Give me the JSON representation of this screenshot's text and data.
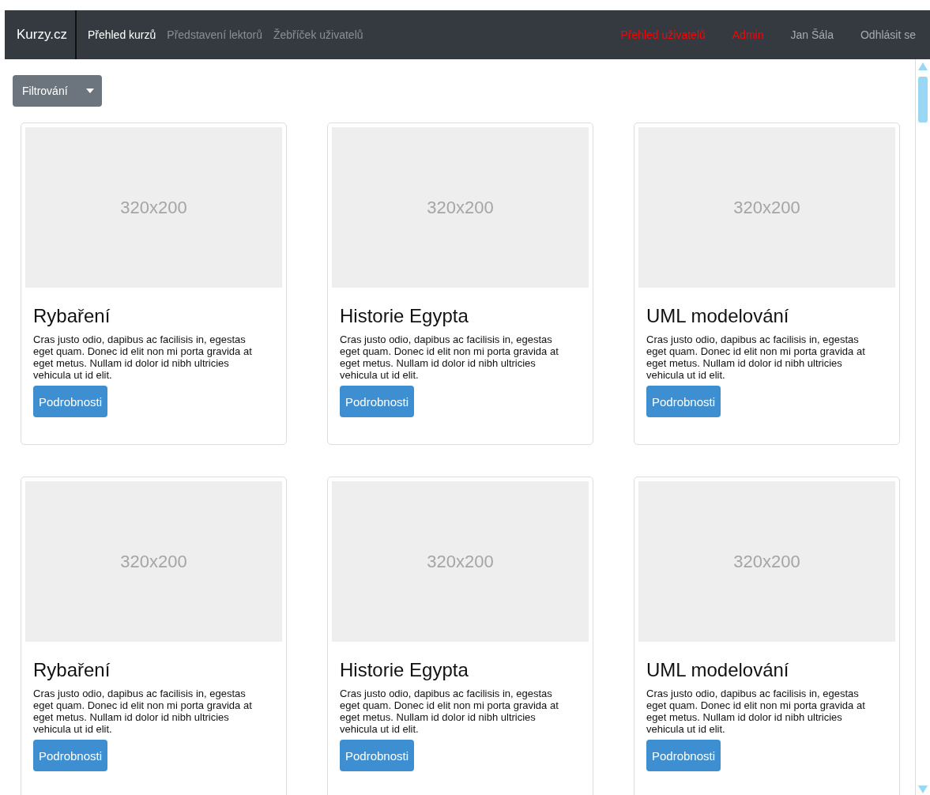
{
  "navbar": {
    "brand": "Kurzy.cz",
    "links": [
      {
        "label": "Přehled kurzů",
        "selected": true
      },
      {
        "label": "Představení lektorů",
        "selected": false
      },
      {
        "label": "Žebříček uživatelů",
        "selected": false
      }
    ],
    "right_links": [
      {
        "label": "Přehled uživatelů",
        "kind": "admin"
      },
      {
        "label": "Admin",
        "kind": "admin"
      },
      {
        "label": "Jan Šála",
        "kind": "user"
      },
      {
        "label": "Odhlásit se",
        "kind": "user"
      }
    ]
  },
  "filter_button": {
    "label": "Filtrování"
  },
  "cards": [
    {
      "image": "320x200",
      "title": "Rybaření",
      "text": "Cras justo odio, dapibus ac facilisis in, egestas eget quam. Donec id elit non mi porta gravida at eget metus. Nullam id dolor id nibh ultricies vehicula ut id elit.",
      "button": "Podrobnosti"
    },
    {
      "image": "320x200",
      "title": "Historie Egypta",
      "text": "Cras justo odio, dapibus ac facilisis in, egestas eget quam. Donec id elit non mi porta gravida at eget metus. Nullam id dolor id nibh ultricies vehicula ut id elit.",
      "button": "Podrobnosti"
    },
    {
      "image": "320x200",
      "title": "UML modelování",
      "text": "Cras justo odio, dapibus ac facilisis in, egestas eget quam. Donec id elit non mi porta gravida at eget metus. Nullam id dolor id nibh ultricies vehicula ut id elit.",
      "button": "Podrobnosti"
    },
    {
      "image": "320x200",
      "title": "Rybaření",
      "text": "Cras justo odio, dapibus ac facilisis in, egestas eget quam. Donec id elit non mi porta gravida at eget metus. Nullam id dolor id nibh ultricies vehicula ut id elit.",
      "button": "Podrobnosti"
    },
    {
      "image": "320x200",
      "title": "Historie Egypta",
      "text": "Cras justo odio, dapibus ac facilisis in, egestas eget quam. Donec id elit non mi porta gravida at eget metus. Nullam id dolor id nibh ultricies vehicula ut id elit.",
      "button": "Podrobnosti"
    },
    {
      "image": "320x200",
      "title": "UML modelování",
      "text": "Cras justo odio, dapibus ac facilisis in, egestas eget quam. Donec id elit non mi porta gravida at eget metus. Nullam id dolor id nibh ultricies vehicula ut id elit.",
      "button": "Podrobnosti"
    }
  ]
}
